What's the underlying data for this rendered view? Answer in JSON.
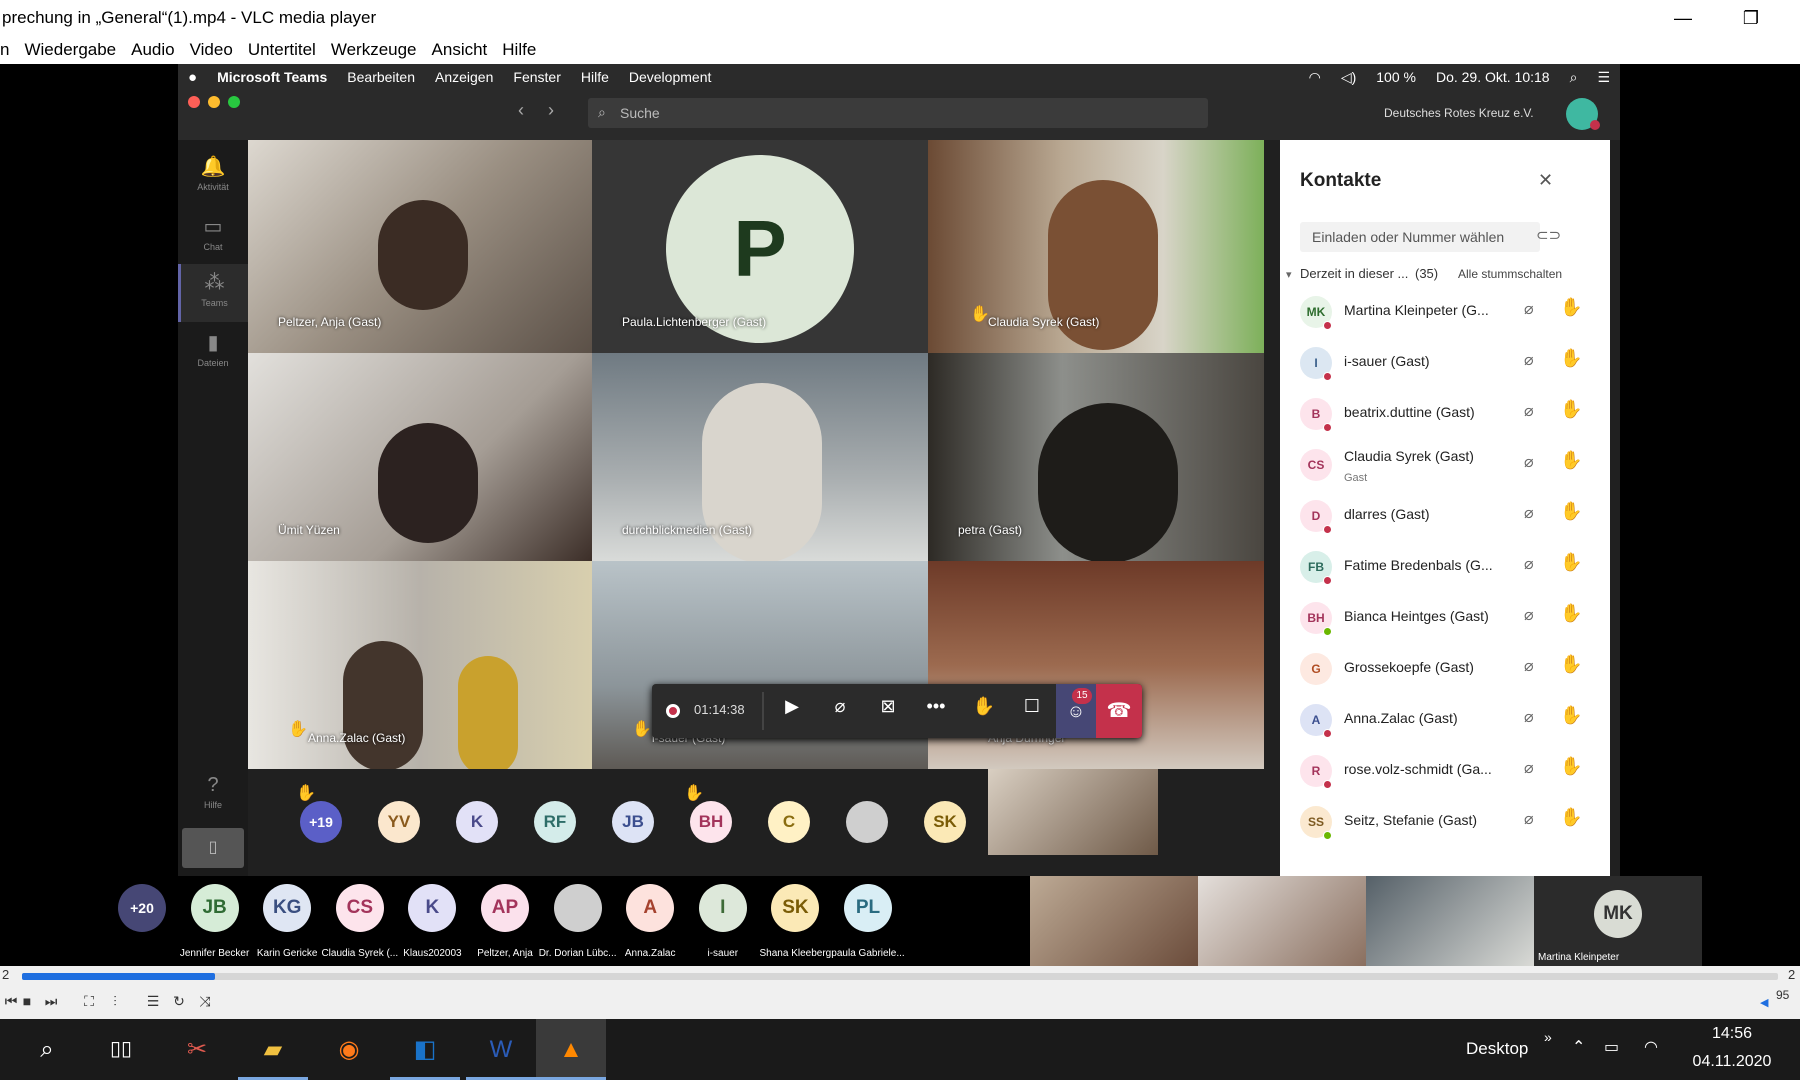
{
  "vlc": {
    "title": "prechung in „General“(1).mp4 - VLC media player",
    "minimize_glyph": "—",
    "restore_glyph": "❐",
    "menu": [
      "n",
      "Wiedergabe",
      "Audio",
      "Video",
      "Untertitel",
      "Werkzeuge",
      "Ansicht",
      "Hilfe"
    ],
    "elapsed": "2",
    "remaining": "2",
    "volume": "95",
    "progress_fraction": 0.11
  },
  "mac": {
    "app": "Microsoft Teams",
    "menu": [
      "Bearbeiten",
      "Anzeigen",
      "Fenster",
      "Hilfe",
      "Development"
    ],
    "battery": "100 %",
    "datetime": "Do. 29. Okt. 10:18"
  },
  "teams": {
    "search_placeholder": "Suche",
    "org": "Deutsches Rotes Kreuz e.V.",
    "rail": [
      "Aktivität",
      "Chat",
      "Teams",
      "Dateien",
      "Hilfe"
    ],
    "tiles": [
      {
        "name": "Peltzer, Anja (Gast)",
        "hand": false
      },
      {
        "name": "Paula.Lichtenberger (Gast)",
        "hand": false,
        "initial": "P"
      },
      {
        "name": "Claudia Syrek (Gast)",
        "hand": true
      },
      {
        "name": "Ümit Yüzen",
        "hand": false
      },
      {
        "name": "durchblickmedien (Gast)",
        "hand": false
      },
      {
        "name": "petra (Gast)",
        "hand": false
      },
      {
        "name": "Anna.Zalac (Gast)",
        "hand": true
      },
      {
        "name": "i-sauer (Gast)",
        "hand": true
      },
      {
        "name": "Anja Durringer",
        "hand": true
      }
    ],
    "call": {
      "timer": "01:14:38",
      "badge": "15"
    },
    "strip": [
      {
        "initials": "+19",
        "bg": "#5b5fc7",
        "fg": "#ffffff"
      },
      {
        "initials": "YV",
        "bg": "#fbe7cd",
        "fg": "#8a5a1d"
      },
      {
        "initials": "K",
        "bg": "#e2e1f7",
        "fg": "#4a4a8a"
      },
      {
        "initials": "RF",
        "bg": "#d4ecea",
        "fg": "#2d6d68"
      },
      {
        "initials": "JB",
        "bg": "#dde3f5",
        "fg": "#3c4f8f"
      },
      {
        "initials": "BH",
        "bg": "#fde4ec",
        "fg": "#a3345b"
      },
      {
        "initials": "C",
        "bg": "#fff1c5",
        "fg": "#8a6d10"
      },
      {
        "initials": "",
        "bg": "#cfcfcf",
        "fg": "#333333"
      },
      {
        "initials": "SK",
        "bg": "#fbe9b6",
        "fg": "#7a5c06"
      }
    ],
    "panel": {
      "title": "Kontakte",
      "invite": "Einladen oder Nummer wählen",
      "section": "Derzeit in dieser ...",
      "count": "(35)",
      "mute_all": "Alle stummschalten",
      "people": [
        {
          "initials": "MK",
          "name": "Martina Kleinpeter (G...",
          "sub": "",
          "bg": "#e8f4e8",
          "fg": "#2e6d2e",
          "status": "#c4314b"
        },
        {
          "initials": "I",
          "name": "i-sauer (Gast)",
          "sub": "",
          "bg": "#dce7f2",
          "fg": "#3a5f8a",
          "status": "#c4314b"
        },
        {
          "initials": "B",
          "name": "beatrix.duttine (Gast)",
          "sub": "",
          "bg": "#fde4ec",
          "fg": "#a3345b",
          "status": "#c4314b"
        },
        {
          "initials": "CS",
          "name": "Claudia Syrek (Gast)",
          "sub": "Gast",
          "bg": "#fde4ec",
          "fg": "#a3345b",
          "status": ""
        },
        {
          "initials": "D",
          "name": "dlarres (Gast)",
          "sub": "",
          "bg": "#fde4ec",
          "fg": "#a3345b",
          "status": "#c4314b"
        },
        {
          "initials": "FB",
          "name": "Fatime Bredenbals (G...",
          "sub": "",
          "bg": "#d8efe9",
          "fg": "#2c6b5c",
          "status": "#c4314b"
        },
        {
          "initials": "BH",
          "name": "Bianca Heintges (Gast)",
          "sub": "",
          "bg": "#fde4ec",
          "fg": "#a3345b",
          "status": "#6bb700"
        },
        {
          "initials": "G",
          "name": "Grossekoepfe (Gast)",
          "sub": "",
          "bg": "#fde9e1",
          "fg": "#b04d23",
          "status": ""
        },
        {
          "initials": "A",
          "name": "Anna.Zalac (Gast)",
          "sub": "",
          "bg": "#dde3f5",
          "fg": "#3c4f8f",
          "status": "#c4314b"
        },
        {
          "initials": "R",
          "name": "rose.volz-schmidt (Ga...",
          "sub": "",
          "bg": "#fde4ec",
          "fg": "#a3345b",
          "status": "#c4314b"
        },
        {
          "initials": "SS",
          "name": "Seitz, Stefanie (Gast)",
          "sub": "",
          "bg": "#fbe9d0",
          "fg": "#7d5a21",
          "status": "#6bb700"
        }
      ]
    }
  },
  "outer_strip": [
    {
      "initials": "+20",
      "caption": "",
      "bg": "#464775",
      "fg": "#ffffff"
    },
    {
      "initials": "JB",
      "caption": "Jennifer Becker",
      "bg": "#d6ecd7",
      "fg": "#2f6b33"
    },
    {
      "initials": "KG",
      "caption": "Karin Gericke",
      "bg": "#dfe6f3",
      "fg": "#3a4f80"
    },
    {
      "initials": "CS",
      "caption": "Claudia Syrek (...",
      "bg": "#fde4ec",
      "fg": "#a3345b"
    },
    {
      "initials": "K",
      "caption": "Klaus202003",
      "bg": "#e2e1f7",
      "fg": "#4a4a8a"
    },
    {
      "initials": "AP",
      "caption": "Peltzer, Anja",
      "bg": "#fbe1ec",
      "fg": "#a3345b"
    },
    {
      "initials": "",
      "caption": "Dr. Dorian Lübc...",
      "bg": "#cfcfcf",
      "fg": "#333333"
    },
    {
      "initials": "A",
      "caption": "Anna.Zalac",
      "bg": "#fde2dd",
      "fg": "#a5422f"
    },
    {
      "initials": "I",
      "caption": "i-sauer",
      "bg": "#dde8da",
      "fg": "#3e6b38"
    },
    {
      "initials": "SK",
      "caption": "Shana Kleeberg",
      "bg": "#fbe9b6",
      "fg": "#7a5c06"
    },
    {
      "initials": "PL",
      "caption": "paula Gabriele...",
      "bg": "#d9eef5",
      "fg": "#2a6b80"
    }
  ],
  "outer_mk": {
    "initials": "MK",
    "caption": "Martina Kleinpeter"
  },
  "taskbar": {
    "desktop": "Desktop",
    "time": "14:56",
    "date": "04.11.2020"
  }
}
